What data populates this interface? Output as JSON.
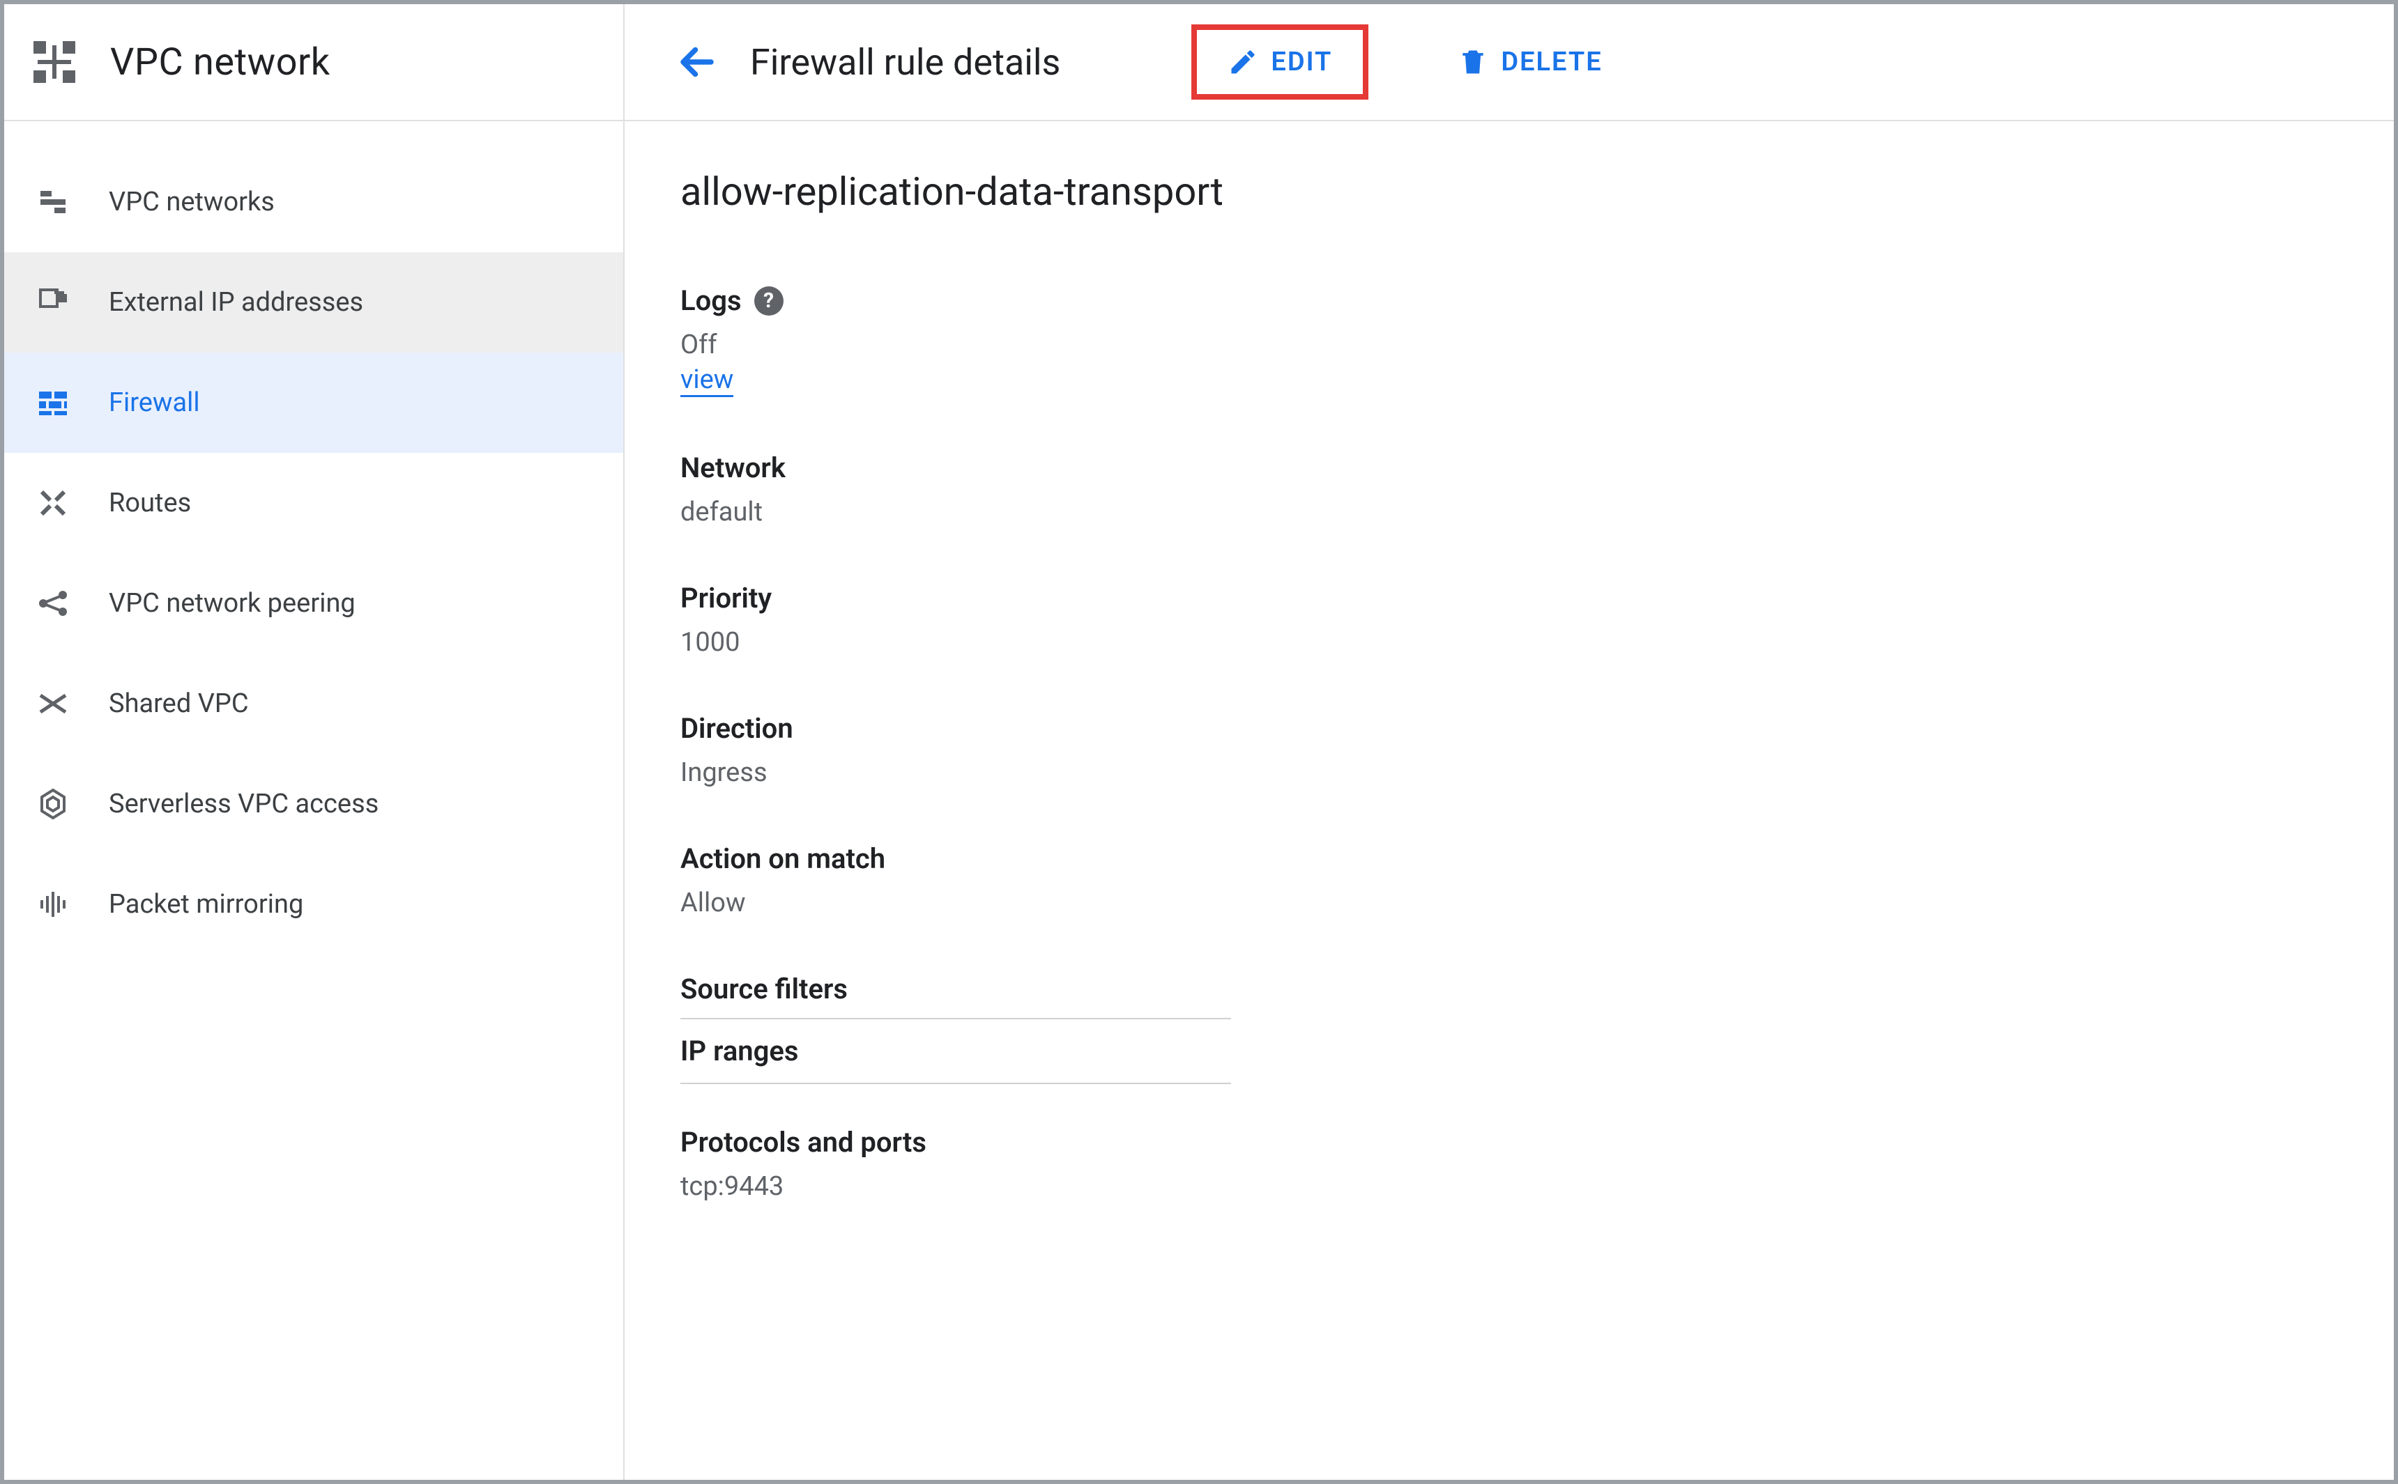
{
  "product": {
    "title": "VPC network"
  },
  "sidebar": {
    "items": [
      {
        "label": "VPC networks",
        "icon": "vpc-networks-icon"
      },
      {
        "label": "External IP addresses",
        "icon": "external-ip-icon"
      },
      {
        "label": "Firewall",
        "icon": "firewall-icon"
      },
      {
        "label": "Routes",
        "icon": "routes-icon"
      },
      {
        "label": "VPC network peering",
        "icon": "peering-icon"
      },
      {
        "label": "Shared VPC",
        "icon": "shared-vpc-icon"
      },
      {
        "label": "Serverless VPC access",
        "icon": "serverless-icon"
      },
      {
        "label": "Packet mirroring",
        "icon": "mirroring-icon"
      }
    ],
    "active_index": 2,
    "highlight_index": 1
  },
  "header": {
    "page_title": "Firewall rule details",
    "edit_label": "EDIT",
    "delete_label": "DELETE"
  },
  "rule": {
    "name": "allow-replication-data-transport",
    "logs_label": "Logs",
    "logs_value": "Off",
    "logs_link": "view",
    "network_label": "Network",
    "network_value": "default",
    "priority_label": "Priority",
    "priority_value": "1000",
    "direction_label": "Direction",
    "direction_value": "Ingress",
    "action_label": "Action on match",
    "action_value": "Allow",
    "source_filters_label": "Source filters",
    "ip_ranges_label": "IP ranges",
    "protocols_label": "Protocols and ports",
    "protocols_value": "tcp:9443"
  }
}
